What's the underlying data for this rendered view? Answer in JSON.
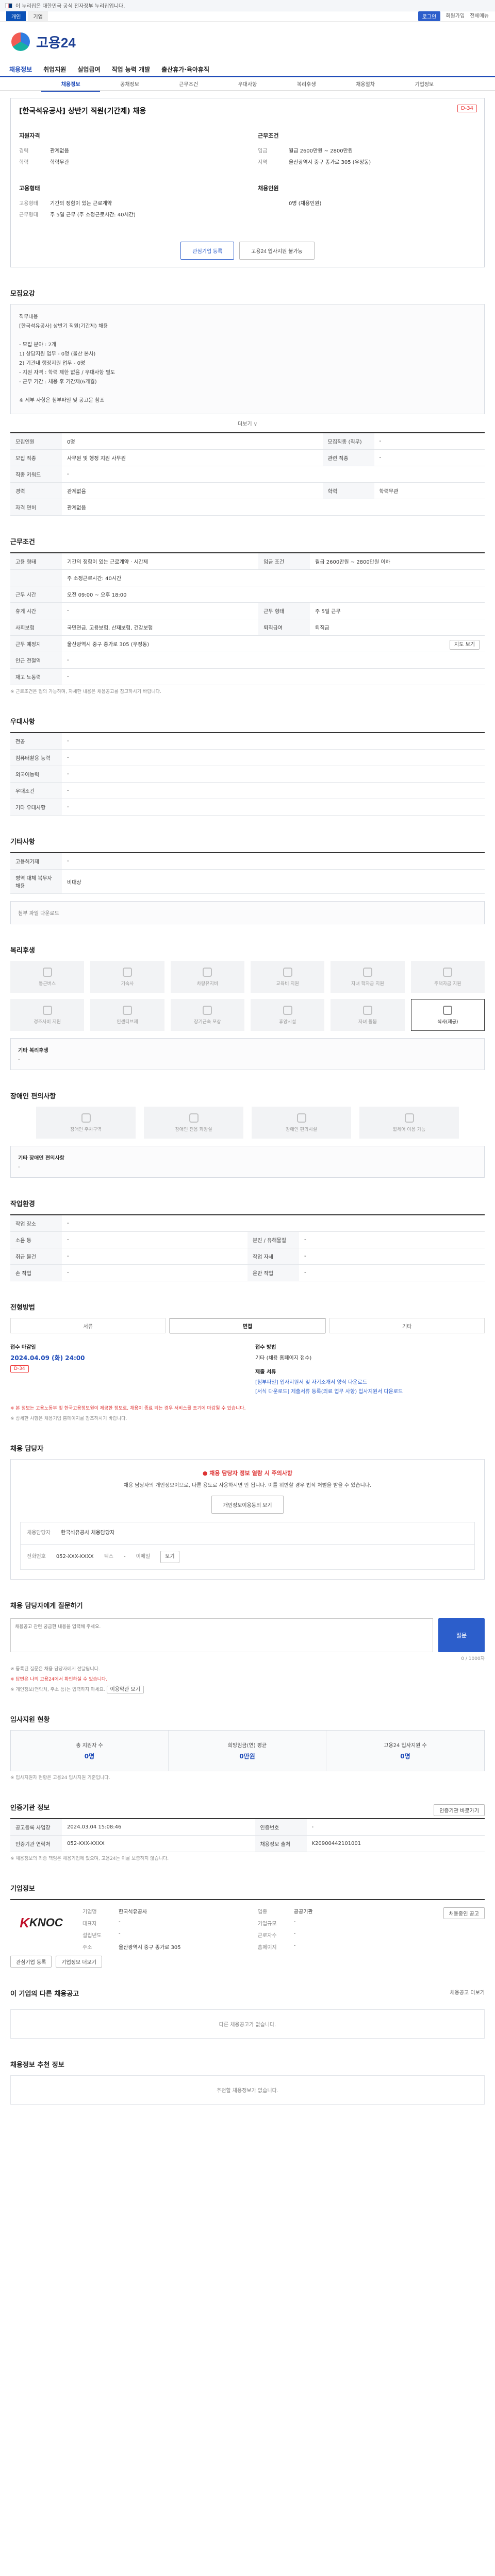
{
  "gov_bar": {
    "text": "이 누리집은 대한민국 공식 전자정부 누리집입니다."
  },
  "topbar": {
    "tabs": [
      "개인",
      "기업"
    ],
    "links": [
      "로그인",
      "회원가입",
      "전체메뉴"
    ]
  },
  "logo": {
    "text": "고용24"
  },
  "gnb": [
    "채용정보",
    "취업지원",
    "실업급여",
    "직업 능력 개발",
    "출산휴가·육아휴직"
  ],
  "subtabs": [
    "채용정보",
    "공채정보",
    "근무조건",
    "우대사항",
    "복리후생",
    "채용절차",
    "기업정보"
  ],
  "job": {
    "title": "[한국석유공사] 상반기 직원(기간제) 채용",
    "dday": "D-34",
    "company_heading": "지원자격",
    "company_rows": [
      {
        "k": "경력",
        "v": "관계없음"
      },
      {
        "k": "학력",
        "v": "학력무관"
      }
    ],
    "cond_heading": "근무조건",
    "cond_rows": [
      {
        "k": "임금",
        "v": "월급 2600만원 ~ 2800만원"
      },
      {
        "k": "지역",
        "v": "울산광역시 중구 종가로 305 (우정동)"
      }
    ],
    "work_heading": "고용형태",
    "work_rows": [
      {
        "k": "고용형태",
        "v": "기간의 정함이 있는 근로계약"
      },
      {
        "k": "근무형태",
        "v": "주 5일 근무 (주 소정근로시간: 40시간)"
      }
    ],
    "recruit_heading": "채용인원",
    "recruit_rows": [
      {
        "k": "",
        "v": "0명 (채용인원)"
      }
    ],
    "btn_interest": "관심기업 등록",
    "btn_apply": "고용24 입사지원 불가능"
  },
  "recruit": {
    "heading": "모집요강",
    "body": "직무내용\n[한국석유공사] 상반기 직원(기간제) 채용\n\n- 모집 분야 : 2개\n  1) 상담지원 업무 - 0명 (울산 본사)\n  2) 기관내 행정지원 업무 - 0명\n- 지원 자격 : 학력 제한 없음 / 우대사항 별도\n- 근무 기간 : 채용 후 기간제(6개월)\n\n※ 세부 사항은 첨부파일 및 공고문 참조",
    "more": "더보기 ∨",
    "rows": [
      {
        "k": "모집인원",
        "v": "0명",
        "k2": "모집직종 (직무)",
        "v2": "-"
      },
      {
        "k": "모집 직종",
        "v": "사무원 및 행정 지원 사무원",
        "k2": "관련 직종",
        "v2": "-"
      },
      {
        "k": "직종 키워드",
        "v": "-",
        "k2": "",
        "v2": ""
      },
      {
        "k": "경력",
        "v": "관계없음",
        "k2": "학력",
        "v2": "학력무관"
      },
      {
        "k": "자격 면허",
        "v": "관계없음",
        "k2": "",
        "v2": ""
      }
    ]
  },
  "conditions": {
    "heading": "근무조건",
    "rows": [
      {
        "k": "고용 형태",
        "v": "기간의 정함이 있는 근로계약 · 시간제",
        "k2": "임금 조건",
        "v2": "월급 2600만원 ~ 2800만원 이하"
      },
      {
        "k": "",
        "v": "주 소정근로시간: 40시간",
        "k2": "",
        "v2": ""
      },
      {
        "k": "근무 시간",
        "v": "오전 09:00 ~ 오후 18:00",
        "k2": "",
        "v2": ""
      },
      {
        "k": "휴게 시간",
        "v": "-",
        "k2": "근무 형태",
        "v2": "주 5일 근무"
      },
      {
        "k": "사회보험",
        "v": "국민연금, 고용보험, 산재보험, 건강보험",
        "k2": "퇴직급여",
        "v2": "퇴직금"
      },
      {
        "k": "근무 예정지",
        "v": "울산광역시 중구 종가로 305 (우정동)",
        "k2": "",
        "v2": "지도 보기"
      },
      {
        "k": "인근 전철역",
        "v": "-",
        "k2": "",
        "v2": ""
      },
      {
        "k": "재고 노동력",
        "v": "-",
        "k2": "",
        "v2": ""
      }
    ],
    "note": "※ 근로조건은 협의 가능하며, 자세한 내용은 채용공고를 참고하시기 바랍니다."
  },
  "preference": {
    "heading": "우대사항",
    "rows": [
      {
        "k": "전공",
        "v": "-"
      },
      {
        "k": "컴퓨터활용 능력",
        "v": "-"
      },
      {
        "k": "외국어능력",
        "v": "-"
      },
      {
        "k": "우대조건",
        "v": "-"
      },
      {
        "k": "기타 우대사항",
        "v": "-"
      }
    ]
  },
  "etc": {
    "heading": "기타사항",
    "rows": [
      {
        "k": "고용허가제",
        "v": "-"
      },
      {
        "k": "병역 대체 복무자 채용",
        "v": "비대상"
      }
    ],
    "attach_label": "첨부 파일 다운로드"
  },
  "welfare": {
    "heading": "복리후생",
    "items": [
      "통근버스",
      "기숙사",
      "차량유지비",
      "교육비 지원",
      "자녀 학자금 지원",
      "주택자금 지원",
      "경조사비 지원",
      "인센티브제",
      "장기근속 포상",
      "휴양시설",
      "자녀 돌봄",
      "식사(제공)"
    ],
    "active_index": 11,
    "extra_label": "기타 복리후생",
    "extra_value": "-"
  },
  "disability": {
    "heading": "장애인 편의사항",
    "items": [
      "장애인 주차구역",
      "장애인 전용 화장실",
      "장애인 편의시설",
      "휠체어 이용 가능"
    ],
    "extra_label": "기타 장애인 편의사항",
    "extra_value": "-"
  },
  "workplace": {
    "heading": "작업환경",
    "rows": [
      {
        "k": "작업 장소",
        "v": "-",
        "k2": "",
        "v2": ""
      },
      {
        "k": "소음 등",
        "v": "-",
        "k2": "분진 / 유해물질",
        "v2": "-"
      },
      {
        "k": "취급 물건",
        "v": "-",
        "k2": "작업 자세",
        "v2": "-"
      },
      {
        "k": "손 작업",
        "v": "-",
        "k2": "운반 작업",
        "v2": "-"
      }
    ]
  },
  "process": {
    "heading": "전형방법",
    "tabs": [
      "서류",
      "면접",
      "기타"
    ],
    "active": 1,
    "deadline_label": "접수 마감일",
    "deadline": "2024.04.09 (화) 24:00",
    "deadline_badge": "D-34",
    "method_label": "접수 방법",
    "method": "기타 (채용 홈페이지 접수)",
    "links_label": "제출 서류",
    "links": [
      "[첨부파일] 입사지원서 및 자기소개서 양식 다운로드",
      "[서식 다운로드] 제출서류 등록(의료 업무 사항) 입사지원서 다운로드"
    ],
    "notices": [
      "※ 본 정보는 고용노동부 및 한국고용정보원이 제공한 정보로, 채용이 종료 되는 경우 서비스를 조기에 마감될 수 있습니다.",
      "※ 상세한 사항은 채용기업 홈페이지를 참조하시기 바랍니다."
    ]
  },
  "manager": {
    "heading": "채용 담당자",
    "alert": "채용 담당자 정보 열람 시 주의사항",
    "desc": "채용 담당자의 개인정보이므로, 다른 용도로 사용하시면 안 됩니다. 이를 위반할 경우 법적 처벌을 받을 수 있습니다.",
    "btn": "개인정보이용동의 보기",
    "name_label": "채용담당자",
    "name": "한국석유공사 채용담당자",
    "phone_label": "전화번호",
    "phone": "052-XXX-XXXX",
    "fax_label": "팩스",
    "fax": "-",
    "email_label": "이메일",
    "email": "보기"
  },
  "qa": {
    "heading": "채용 담당자에게 질문하기",
    "placeholder": "채용공고 관련 궁금한 내용을 입력해 주세요.",
    "counter": "0 / 1000자",
    "submit": "질문",
    "notes": [
      "※ 등록된 질문은 채용 담당자에게 전달됩니다.",
      "※ 답변은 나의 고용24에서 확인하실 수 있습니다.",
      "※ 개인정보(연락처, 주소 등)는 입력하지 마세요."
    ],
    "terms_btn": "이용약관 보기"
  },
  "applicants": {
    "heading": "입사지원 현황",
    "items": [
      {
        "label": "총 지원자 수",
        "value": "0명"
      },
      {
        "label": "희망임금(연) 평균",
        "value": "0만원"
      },
      {
        "label": "고용24 입사지원 수",
        "value": "0명"
      }
    ],
    "note": "※ 입사지원자 현황은 고용24 입사지원 기준입니다."
  },
  "agency": {
    "heading": "인증기관 정보",
    "btn": "인증기관 바로가기",
    "rows": [
      {
        "k": "공고등록 사업장",
        "v": "2024.03.04 15:08:46",
        "k2": "인증번호",
        "v2": "-"
      },
      {
        "k": "인증기관 연락처",
        "v": "052-XXX-XXXX",
        "k2": "채용정보 출처",
        "v2": "K20900442101001"
      }
    ],
    "notes": [
      "※ 채용정보의 최종 책임은 채용기업에 있으며, 고용24는 이를 보증하지 않습니다."
    ]
  },
  "company": {
    "heading": "기업정보",
    "logo_text": "KNOC",
    "rows": [
      {
        "k": "기업명",
        "v": "한국석유공사",
        "k2": "업종",
        "v2": "공공기관"
      },
      {
        "k": "대표자",
        "v": "-",
        "k2": "기업규모",
        "v2": "-"
      },
      {
        "k": "설립년도",
        "v": "-",
        "k2": "근로자수",
        "v2": "-"
      },
      {
        "k": "주소",
        "v": "울산광역시 중구 종가로 305",
        "k2": "홈페이지",
        "v2": "-"
      }
    ],
    "btns": [
      "관심기업 등록",
      "기업정보 더보기"
    ],
    "side_btn": "채용중인 공고"
  },
  "same_company": {
    "heading": "이 기업의 다른 채용공고",
    "link": "채용공고 더보기",
    "empty": "다른 채용공고가 없습니다."
  },
  "recommend": {
    "heading": "채용정보 추천 정보",
    "empty": "추천할 채용정보가 없습니다."
  }
}
